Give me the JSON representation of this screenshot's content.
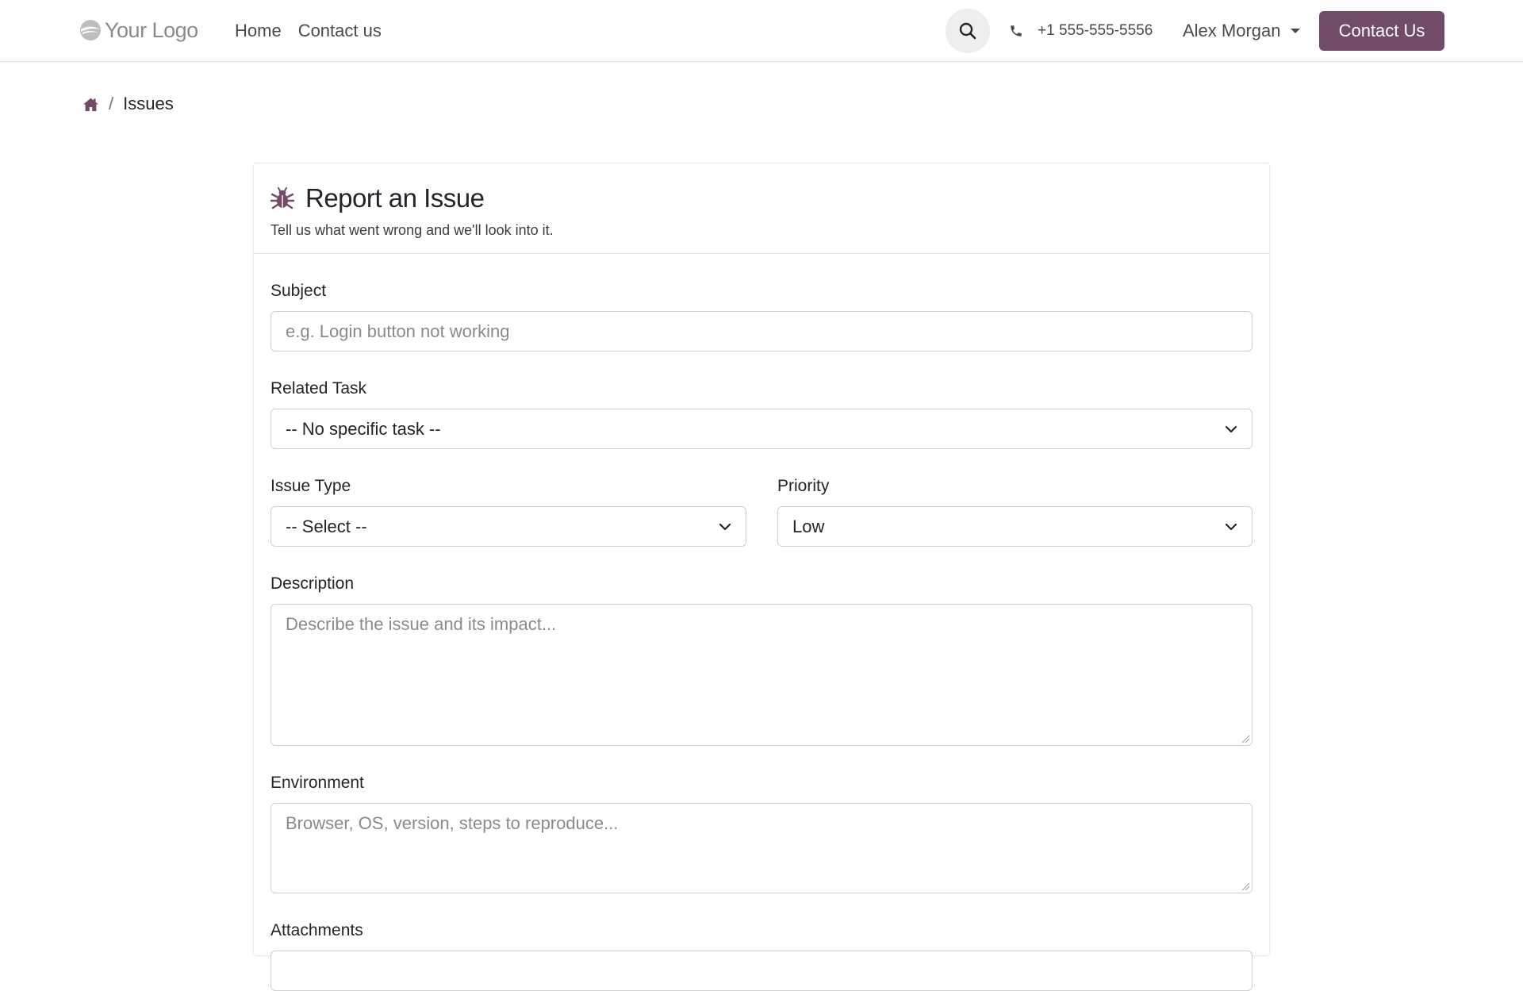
{
  "navbar": {
    "logo_text": "Your Logo",
    "links": [
      "Home",
      "Contact us"
    ],
    "phone": "+1 555-555-5556",
    "user_name": "Alex Morgan",
    "cta_label": "Contact Us"
  },
  "breadcrumb": {
    "separator": "/",
    "current": "Issues"
  },
  "card": {
    "title": "Report an Issue",
    "subtitle": "Tell us what went wrong and we'll look into it."
  },
  "form": {
    "subject": {
      "label": "Subject",
      "placeholder": "e.g. Login button not working"
    },
    "related_task": {
      "label": "Related Task",
      "value": "-- No specific task --"
    },
    "issue_type": {
      "label": "Issue Type",
      "value": "-- Select --"
    },
    "priority": {
      "label": "Priority",
      "value": "Low"
    },
    "description": {
      "label": "Description",
      "placeholder": "Describe the issue and its impact..."
    },
    "environment": {
      "label": "Environment",
      "placeholder": "Browser, OS, version, steps to reproduce..."
    },
    "attachments": {
      "label": "Attachments"
    }
  },
  "colors": {
    "brand": "#714b67",
    "border": "#d0d0d0",
    "placeholder": "#8a8a8a"
  },
  "icons": [
    "search-icon",
    "phone-icon",
    "home-icon",
    "bug-icon",
    "chevron-down-icon"
  ]
}
